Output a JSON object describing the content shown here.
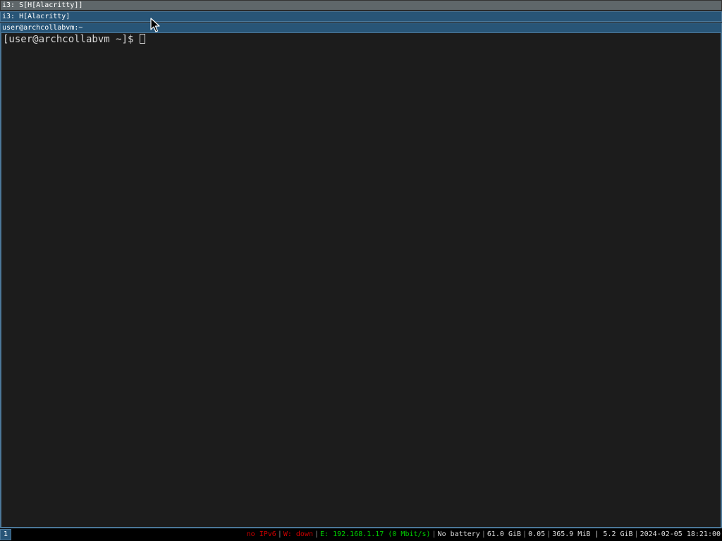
{
  "window_titles": {
    "outer": "i3: S[H[Alacritty]]",
    "inner": "i3: H[Alacritty]",
    "terminal": "user@archcollabvm:~"
  },
  "terminal": {
    "prompt": "[user@archcollabvm ~]$"
  },
  "bar": {
    "workspace": "1",
    "status": {
      "ipv6": "no IPv6",
      "wireless": "W: down",
      "ethernet": "E: 192.168.1.17 (0 Mbit/s)",
      "battery": "No battery",
      "disk": "61.0 GiB",
      "load": "0.05",
      "memory": "365.9 MiB | 5.2 GiB",
      "datetime": "2024-02-05 18:21:00"
    },
    "separator": "|"
  },
  "colors": {
    "focused_title_bg": "#285577",
    "unfocused_title_bg": "#5f676a",
    "border": "#4c7899",
    "terminal_bg": "#1c1c1c",
    "status_bad": "#cc0000",
    "status_good": "#00cc00"
  },
  "icons": {
    "pointer": "mouse-pointer-icon",
    "cursor": "block-cursor"
  }
}
